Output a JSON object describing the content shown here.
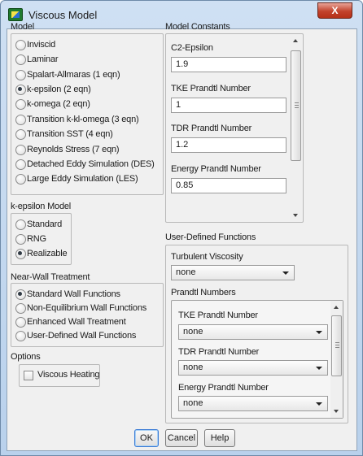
{
  "window": {
    "title": "Viscous Model",
    "close_label": "X"
  },
  "model": {
    "label": "Model",
    "options": [
      {
        "label": "Inviscid",
        "selected": false
      },
      {
        "label": "Laminar",
        "selected": false
      },
      {
        "label": "Spalart-Allmaras (1 eqn)",
        "selected": false
      },
      {
        "label": "k-epsilon (2 eqn)",
        "selected": true
      },
      {
        "label": "k-omega (2 eqn)",
        "selected": false
      },
      {
        "label": "Transition k-kl-omega (3 eqn)",
        "selected": false
      },
      {
        "label": "Transition SST (4 eqn)",
        "selected": false
      },
      {
        "label": "Reynolds Stress (7 eqn)",
        "selected": false
      },
      {
        "label": "Detached Eddy Simulation (DES)",
        "selected": false
      },
      {
        "label": "Large Eddy Simulation (LES)",
        "selected": false
      }
    ]
  },
  "kepsilon_model": {
    "label": "k-epsilon Model",
    "options": [
      {
        "label": "Standard",
        "selected": false
      },
      {
        "label": "RNG",
        "selected": false
      },
      {
        "label": "Realizable",
        "selected": true
      }
    ]
  },
  "near_wall": {
    "label": "Near-Wall Treatment",
    "options": [
      {
        "label": "Standard Wall Functions",
        "selected": true
      },
      {
        "label": "Non-Equilibrium Wall Functions",
        "selected": false
      },
      {
        "label": "Enhanced Wall Treatment",
        "selected": false
      },
      {
        "label": "User-Defined Wall Functions",
        "selected": false
      }
    ]
  },
  "options": {
    "label": "Options",
    "viscous_heating": "Viscous Heating"
  },
  "model_constants": {
    "label": "Model Constants",
    "items": [
      {
        "label": "C2-Epsilon",
        "value": "1.9"
      },
      {
        "label": "TKE Prandtl Number",
        "value": "1"
      },
      {
        "label": "TDR Prandtl Number",
        "value": "1.2"
      },
      {
        "label": "Energy Prandtl Number",
        "value": "0.85"
      }
    ]
  },
  "udf": {
    "label": "User-Defined Functions",
    "turbulent_viscosity_label": "Turbulent Viscosity",
    "turbulent_viscosity_value": "none",
    "prandtl_numbers_label": "Prandtl Numbers",
    "items": [
      {
        "label": "TKE Prandtl Number",
        "value": "none"
      },
      {
        "label": "TDR Prandtl Number",
        "value": "none"
      },
      {
        "label": "Energy Prandtl Number",
        "value": "none"
      }
    ]
  },
  "buttons": {
    "ok": "OK",
    "cancel": "Cancel",
    "help": "Help"
  }
}
